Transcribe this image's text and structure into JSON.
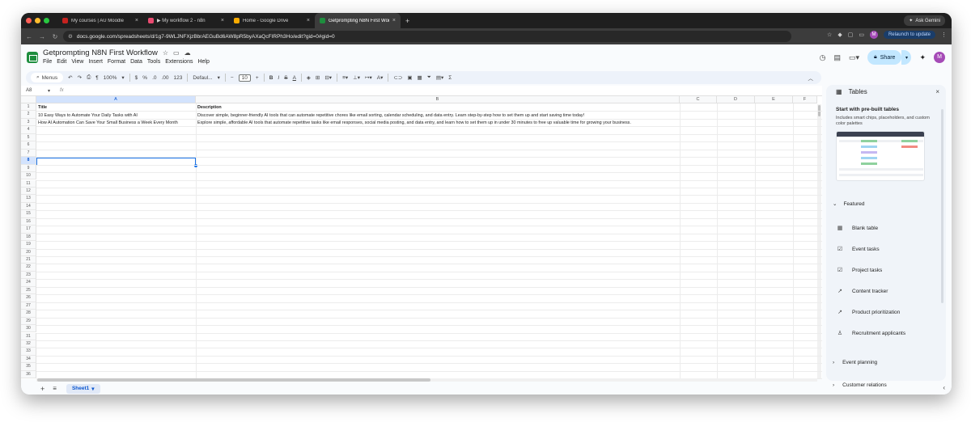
{
  "browser": {
    "tabs": [
      {
        "label": "My courses | AU Moodle",
        "close": "×",
        "color": "#c5221f"
      },
      {
        "label": "▶ My workflow 2 - n8n",
        "close": "×",
        "color": "#ea4b71"
      },
      {
        "label": "Home - Google Drive",
        "close": "×",
        "color": "#f9ab00"
      },
      {
        "label": "Getprompting N8N First Wor...",
        "close": "×",
        "color": "#1e8e3e"
      }
    ],
    "new_tab": "+",
    "ask_gemini": "Ask Gemini",
    "url": "docs.google.com/spreadsheets/d/1g7-9WLJNFXjzBbrAEGuBd6AW8pR5byAXaQcFIRPh3Ho/edit?gid=0#gid=0",
    "profile_initial": "M",
    "relaunch": "Relaunch to update"
  },
  "doc": {
    "title": "Getprompting N8N First Workflow",
    "menu": [
      "File",
      "Edit",
      "View",
      "Insert",
      "Format",
      "Data",
      "Tools",
      "Extensions",
      "Help"
    ],
    "share_label": "Share",
    "avatar_initial": "M"
  },
  "toolbar": {
    "menus_label": "Menus",
    "zoom": "100%",
    "currency": "$",
    "percent": "%",
    "dec_decrease": ".0",
    "dec_increase": ".00",
    "number_format": "123",
    "font": "Defaul...",
    "font_size": "10"
  },
  "formula_bar": {
    "name_box": "A8",
    "fx": "fx"
  },
  "grid": {
    "columns": [
      "A",
      "B",
      "C",
      "D",
      "E",
      "F"
    ],
    "selected_column": "A",
    "selected_row": 8,
    "row_count": 36,
    "rows": [
      [
        "Title",
        "Description"
      ],
      [
        "10 Easy Ways to Automate Your Daily Tasks with AI",
        "Discover simple, beginner-friendly AI tools that can automate repetitive chores like email sorting, calendar scheduling, and data entry. Learn step-by-step how to set them up and start saving time today!"
      ],
      [
        "How AI Automation Can Save Your Small Business a Week Every Month",
        "Explore simple, affordable AI tools that automate repetitive tasks like email responses, social media posting, and data entry, and learn how to set them up in under 30 minutes to free up valuable time for growing your business."
      ]
    ]
  },
  "sheets": {
    "add": "+",
    "all_sheets": "≡",
    "active_sheet": "Sheet1"
  },
  "panel": {
    "title": "Tables",
    "close": "×",
    "subtitle": "Start with pre-built tables",
    "description": "Includes smart chips, placeholders, and custom color palettes",
    "featured_label": "Featured",
    "featured_items": [
      {
        "label": "Blank table",
        "icon": "table-icon"
      },
      {
        "label": "Event tasks",
        "icon": "checklist-icon"
      },
      {
        "label": "Project tasks",
        "icon": "checklist-icon"
      },
      {
        "label": "Content tracker",
        "icon": "trend-icon"
      },
      {
        "label": "Product prioritization",
        "icon": "trend-icon"
      },
      {
        "label": "Recruitment applicants",
        "icon": "person-icon"
      }
    ],
    "groups": [
      {
        "label": "Event planning"
      },
      {
        "label": "Customer relations"
      }
    ]
  }
}
